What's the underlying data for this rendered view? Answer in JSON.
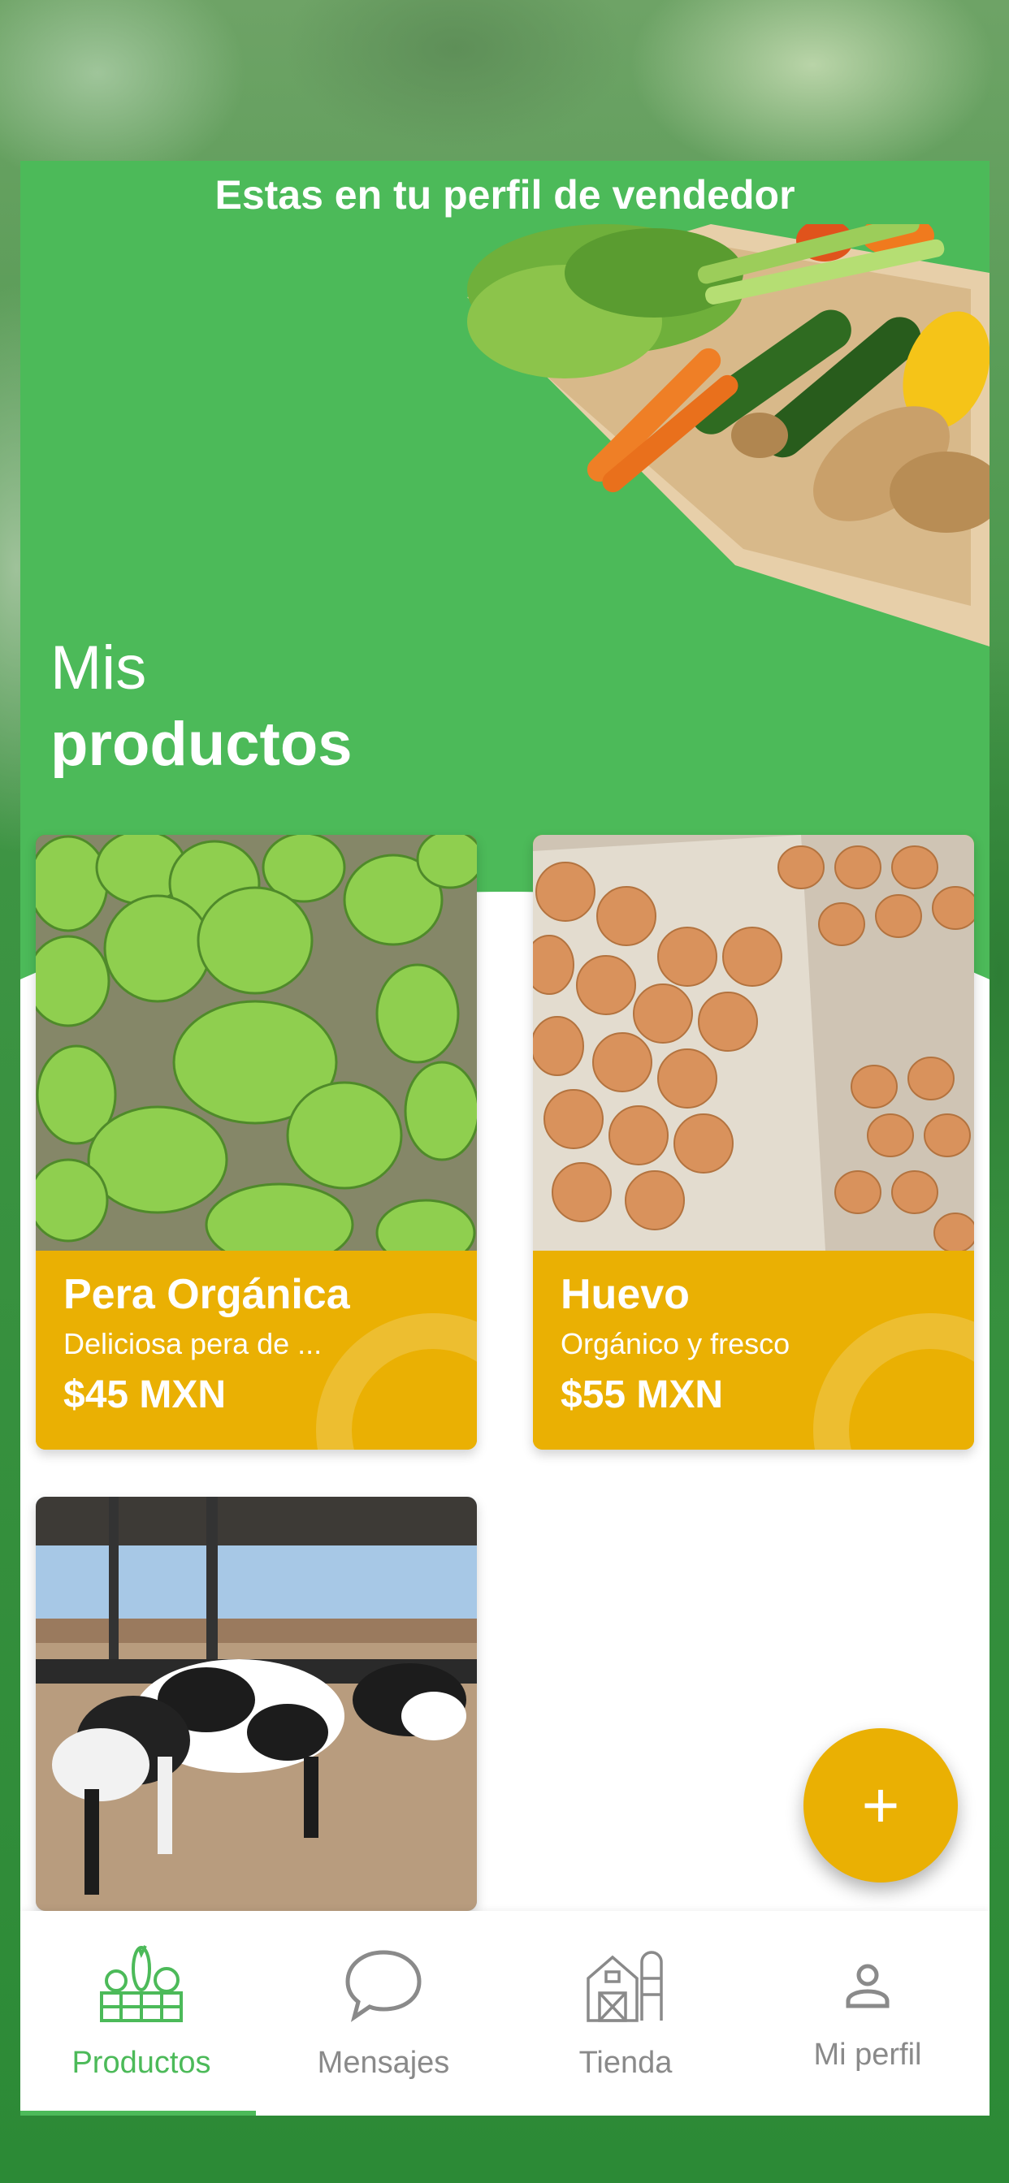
{
  "header": {
    "title": "Estas en tu perfil de vendedor"
  },
  "section": {
    "title_line1": "Mis",
    "title_line2": "productos"
  },
  "products": [
    {
      "name": "Pera Orgánica",
      "description": "Deliciosa pera de ...",
      "price": "$45 MXN"
    },
    {
      "name": "Huevo",
      "description": "Orgánico y fresco",
      "price": "$55 MXN"
    }
  ],
  "fab": {
    "label": "+"
  },
  "bottom_nav": {
    "items": [
      {
        "label": "Productos",
        "icon": "vegetable-crate-icon",
        "active": true
      },
      {
        "label": "Mensajes",
        "icon": "chat-bubble-icon",
        "active": false
      },
      {
        "label": "Tienda",
        "icon": "barn-icon",
        "active": false
      },
      {
        "label": "Mi perfil",
        "icon": "user-icon",
        "active": false
      }
    ]
  },
  "colors": {
    "primary_green": "#4cba59",
    "accent_yellow": "#eab003",
    "muted_gray": "#8a8a8a"
  }
}
